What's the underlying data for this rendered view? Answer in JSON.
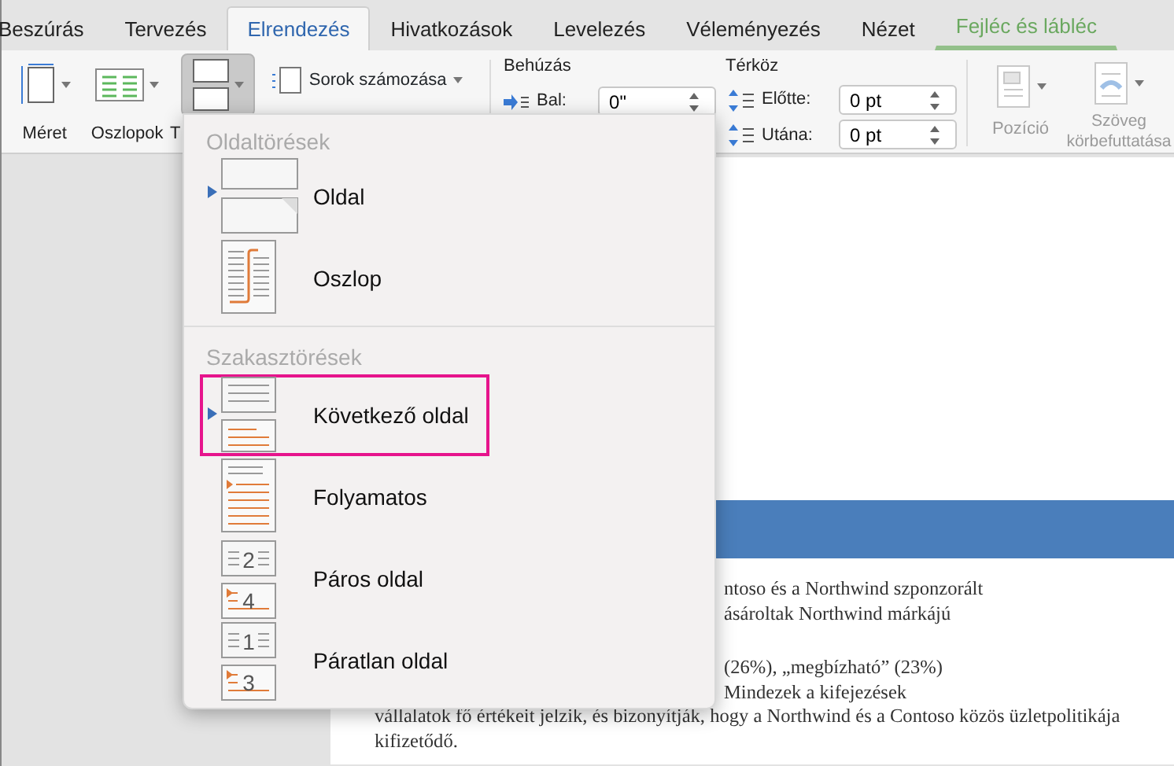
{
  "tabs": [
    {
      "label": "Beszúrás",
      "selected": false,
      "contextual": false
    },
    {
      "label": "Tervezés",
      "selected": false,
      "contextual": false
    },
    {
      "label": "Elrendezés",
      "selected": true,
      "contextual": false
    },
    {
      "label": "Hivatkozások",
      "selected": false,
      "contextual": false
    },
    {
      "label": "Levelezés",
      "selected": false,
      "contextual": false
    },
    {
      "label": "Véleményezés",
      "selected": false,
      "contextual": false
    },
    {
      "label": "Nézet",
      "selected": false,
      "contextual": false
    },
    {
      "label": "Fejléc és lábléc",
      "selected": false,
      "contextual": true
    }
  ],
  "ribbon": {
    "buttons": [
      {
        "kind": "size",
        "label": "Méret",
        "pressed": false
      },
      {
        "kind": "columns",
        "label": "Oszlopok",
        "pressed": false
      },
      {
        "kind": "breaks",
        "label": "T",
        "pressed": true
      }
    ],
    "line_numbers": {
      "label": "Sorok számozása"
    },
    "indent": {
      "title": "Behúzás",
      "fields": [
        {
          "label": "Bal:",
          "value": "0\""
        }
      ]
    },
    "spacing": {
      "title": "Térköz",
      "fields": [
        {
          "label": "Előtte:",
          "value": "0 pt"
        },
        {
          "label": "Utána:",
          "value": "0 pt"
        }
      ]
    },
    "arrange": [
      {
        "kind": "position",
        "label": "Pozíció",
        "disabled": true
      },
      {
        "kind": "wrap",
        "label": "Szöveg körbefuttatása",
        "disabled": true
      }
    ]
  },
  "breaks_menu": {
    "sections": [
      {
        "title": "Oldaltörések",
        "items": [
          {
            "kind": "page",
            "label": "Oldal",
            "highlighted": false
          },
          {
            "kind": "column",
            "label": "Oszlop",
            "highlighted": false
          }
        ]
      },
      {
        "title": "Szakasztörések",
        "items": [
          {
            "kind": "next",
            "label": "Következő oldal",
            "highlighted": true
          },
          {
            "kind": "continuous",
            "label": "Folyamatos",
            "highlighted": false
          },
          {
            "kind": "even",
            "label": "Páros oldal",
            "highlighted": false,
            "icon_numbers": [
              "2",
              "4"
            ]
          },
          {
            "kind": "odd",
            "label": "Páratlan oldal",
            "highlighted": false,
            "icon_numbers": [
              "1",
              "3"
            ]
          }
        ]
      }
    ]
  },
  "document": {
    "paragraphs": [
      [
        {
          "text": "ntoso és a Northwind szponzorált",
          "partial": true
        },
        {
          "text": "ásároltak Northwind márkájú",
          "partial": true
        }
      ],
      [
        {
          "text": "(26%), „megbízható” (23%)",
          "partial": true
        },
        {
          "text": "Mindezek a kifejezések",
          "partial": true
        },
        {
          "text": "vállalatok fő értékeit jelzik, és bizonyítják, hogy a Northwind és a Contoso közös üzletpolitikája",
          "partial": false
        },
        {
          "text": "kifizetődő.",
          "partial": false
        }
      ]
    ]
  }
}
